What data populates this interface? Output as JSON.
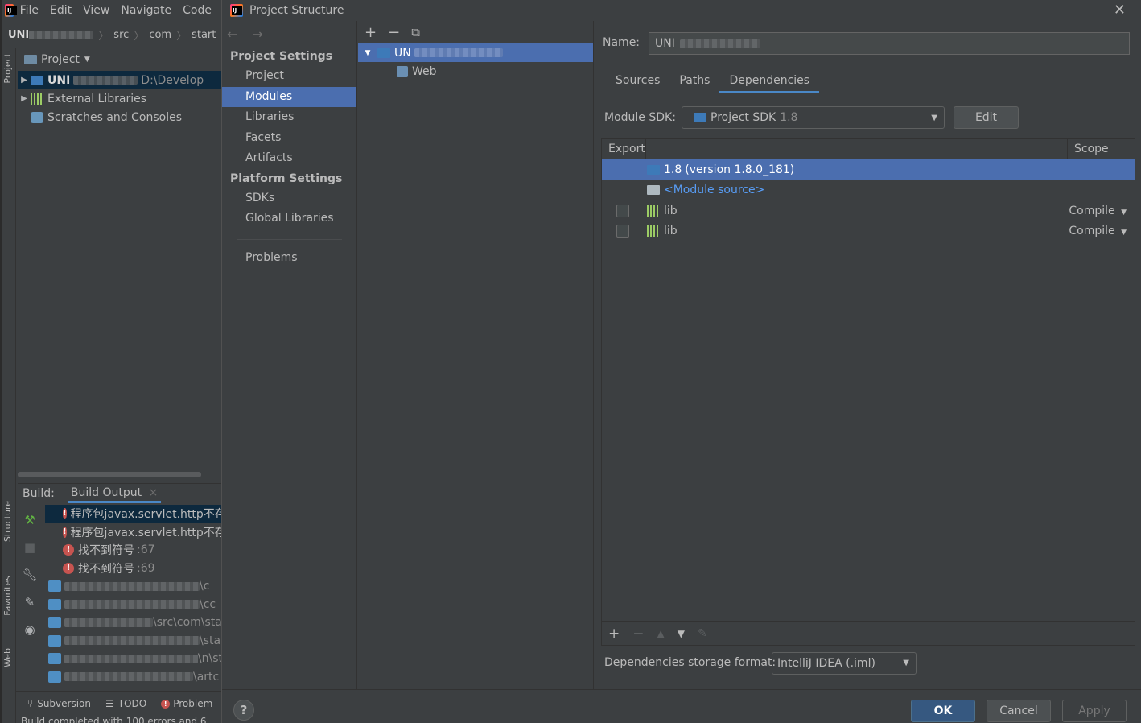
{
  "ide": {
    "menu": [
      "File",
      "Edit",
      "View",
      "Navigate",
      "Code"
    ],
    "breadcrumb": {
      "root": "UNI",
      "items": [
        "src",
        "com",
        "start"
      ]
    },
    "side_tabs": {
      "project": "Project",
      "structure": "Structure",
      "favorites": "Favorites",
      "web": "Web"
    },
    "project_pane": {
      "header": "Project",
      "tree": [
        {
          "label": "UNI",
          "path": "D:\\Develop"
        },
        {
          "label": "External Libraries"
        },
        {
          "label": "Scratches and Consoles"
        }
      ]
    },
    "build": {
      "label": "Build:",
      "tab": "Build Output",
      "tab_close": "×",
      "errors": [
        {
          "text": "程序包javax.servlet.http不存",
          "line": ""
        },
        {
          "text": "程序包javax.servlet.http不存",
          "line": ""
        },
        {
          "text": "找不到符号",
          "line": ":67"
        },
        {
          "text": "找不到符号",
          "line": ":69"
        }
      ],
      "file_suffixes": [
        "\\c",
        "\\cc",
        "\\src\\com\\sta",
        "\\sta",
        "\\n\\st",
        "\\artc"
      ]
    },
    "statusbar": {
      "tabs": [
        "Subversion",
        "TODO",
        "Problem"
      ],
      "status": "Build completed with 100 errors and 6"
    }
  },
  "dialog": {
    "title": "Project Structure",
    "close": "✕",
    "nav": {
      "project_settings_heading": "Project Settings",
      "project_settings": [
        "Project",
        "Modules",
        "Libraries",
        "Facets",
        "Artifacts"
      ],
      "platform_settings_heading": "Platform Settings",
      "platform_settings": [
        "SDKs",
        "Global Libraries"
      ],
      "problems": "Problems"
    },
    "modules": {
      "toolbar": [
        "+",
        "−",
        "⧉"
      ],
      "tree": [
        {
          "label": "UN"
        },
        {
          "label": "Web"
        }
      ]
    },
    "detail": {
      "name_label": "Name:",
      "name_value": "UNI",
      "tabs": [
        "Sources",
        "Paths",
        "Dependencies"
      ],
      "active_tab": "Dependencies",
      "sdk_label": "Module SDK:",
      "sdk_value": "Project SDK",
      "sdk_version": "1.8",
      "edit_button": "Edit",
      "table": {
        "col_export": "Export",
        "col_scope": "Scope",
        "rows": [
          {
            "name": "1.8",
            "detail": "(version 1.8.0_181)",
            "scope": ""
          },
          {
            "name": "<Module source>",
            "detail": "",
            "scope": ""
          },
          {
            "name": "lib",
            "detail": "",
            "scope": "Compile"
          },
          {
            "name": "lib",
            "detail": "",
            "scope": "Compile"
          }
        ]
      },
      "table_toolbar": [
        "+",
        "−",
        "▲",
        "▼",
        "✎"
      ],
      "format_label": "Dependencies storage format:",
      "format_value": "IntelliJ IDEA (.iml)"
    },
    "footer": {
      "help": "?",
      "ok": "OK",
      "cancel": "Cancel",
      "apply": "Apply"
    }
  },
  "colors": {
    "selection": "#4b6eaf",
    "background": "#3c3f41",
    "link": "#589df6",
    "error": "#c75450"
  }
}
